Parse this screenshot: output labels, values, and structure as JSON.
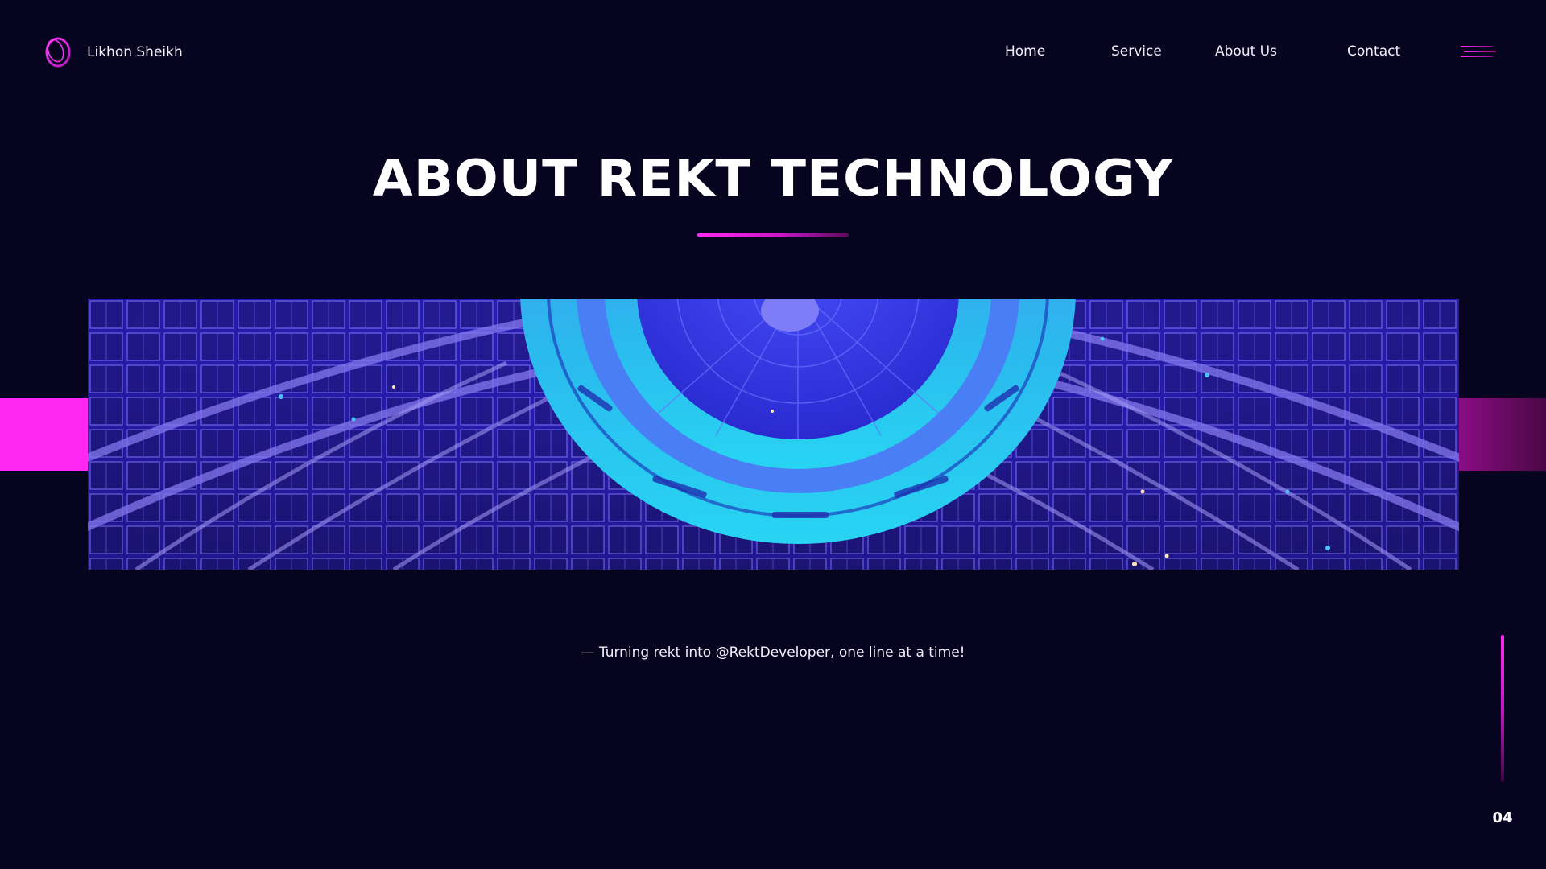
{
  "header": {
    "brand_name": "Likhon Sheikh",
    "logo_icon": "ring-logo-icon",
    "nav": {
      "home": "Home",
      "service": "Service",
      "about": "About Us",
      "contact": "Contact"
    },
    "menu_icon": "hamburger-menu-icon"
  },
  "hero": {
    "title": "ABOUT REKT TECHNOLOGY",
    "image_subject": "illuminated dome ceiling"
  },
  "tagline": "— Turning rekt into @RektDeveloper, one line at a time!",
  "slide": {
    "number": "04"
  },
  "colors": {
    "background": "#070420",
    "accent": "#ff27f2",
    "accent_dark": "#4a0745",
    "text": "#f2eefc",
    "image_blue": "#3b2fd8",
    "image_cyan": "#27c8f0"
  }
}
